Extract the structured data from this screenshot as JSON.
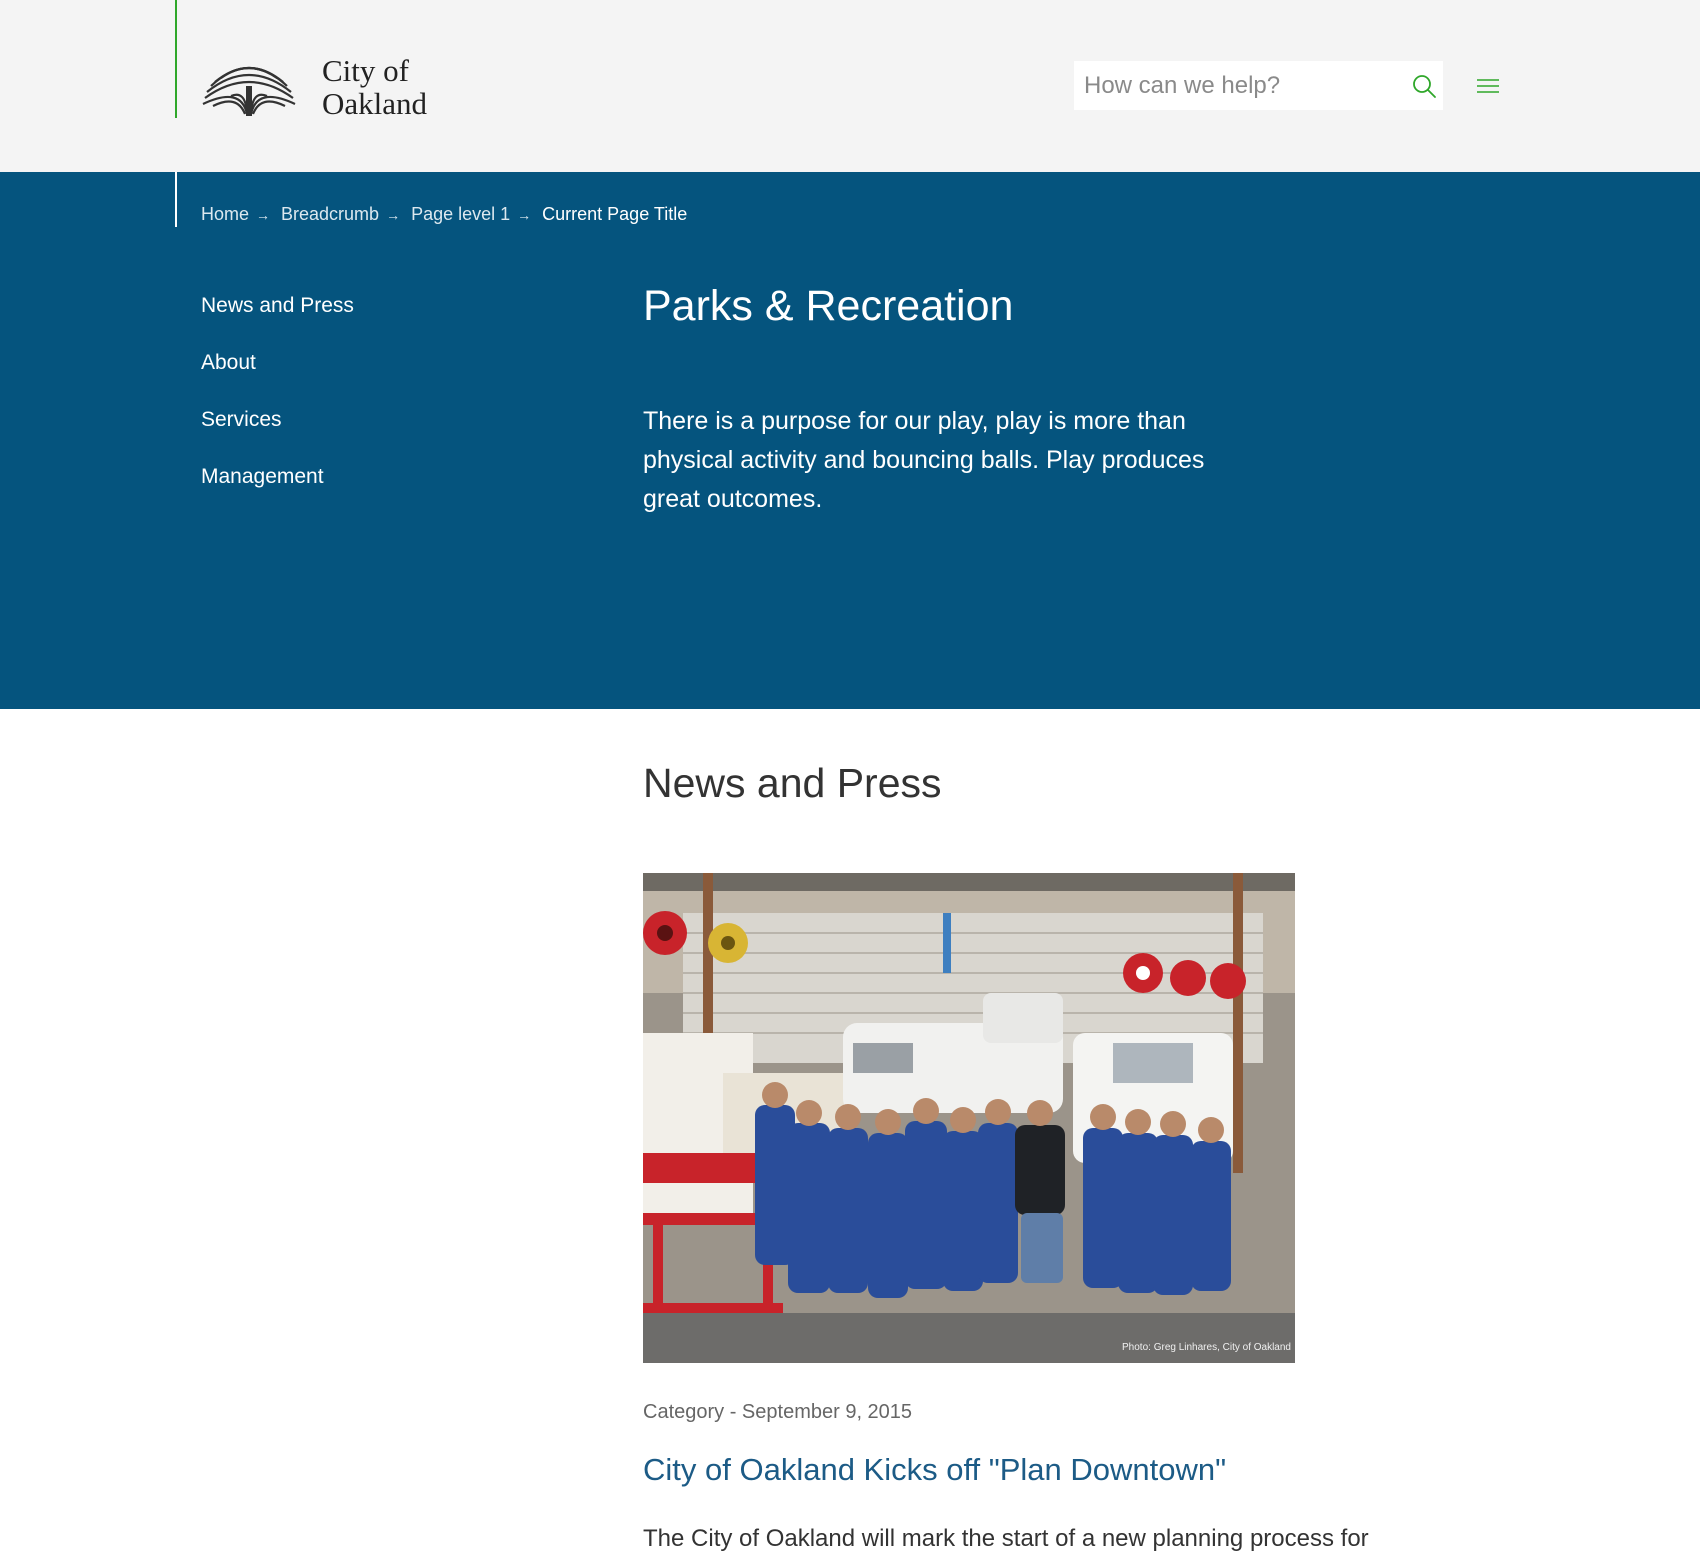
{
  "header": {
    "logo_line1": "City of",
    "logo_line2": "Oakland",
    "search_placeholder": "How can we help?",
    "accent_color": "#2fa72a",
    "background_color": "#f4f4f4",
    "search_icon": "search-icon",
    "menu_icon": "hamburger-menu-icon"
  },
  "breadcrumb": {
    "items": [
      "Home",
      "Breadcrumb",
      "Page level 1"
    ],
    "current": "Current Page Title",
    "separator": "→"
  },
  "hero": {
    "background_color": "#05547e",
    "title": "Parks & Recreation",
    "description": "There is a purpose for our play, play is more than physical activity and bouncing balls. Play produces great outcomes."
  },
  "side_nav": {
    "items": [
      "News and Press",
      "About",
      "Services",
      "Management"
    ]
  },
  "news": {
    "section_title": "News and Press",
    "photo_credit": "Photo: Greg Linhares, City of Oakland",
    "meta": "Category - September 9, 2015",
    "headline": "City of Oakland Kicks off \"Plan Downtown\"",
    "excerpt": "The City of Oakland will mark the start of a new planning process for",
    "headline_color": "#1c5b86"
  }
}
